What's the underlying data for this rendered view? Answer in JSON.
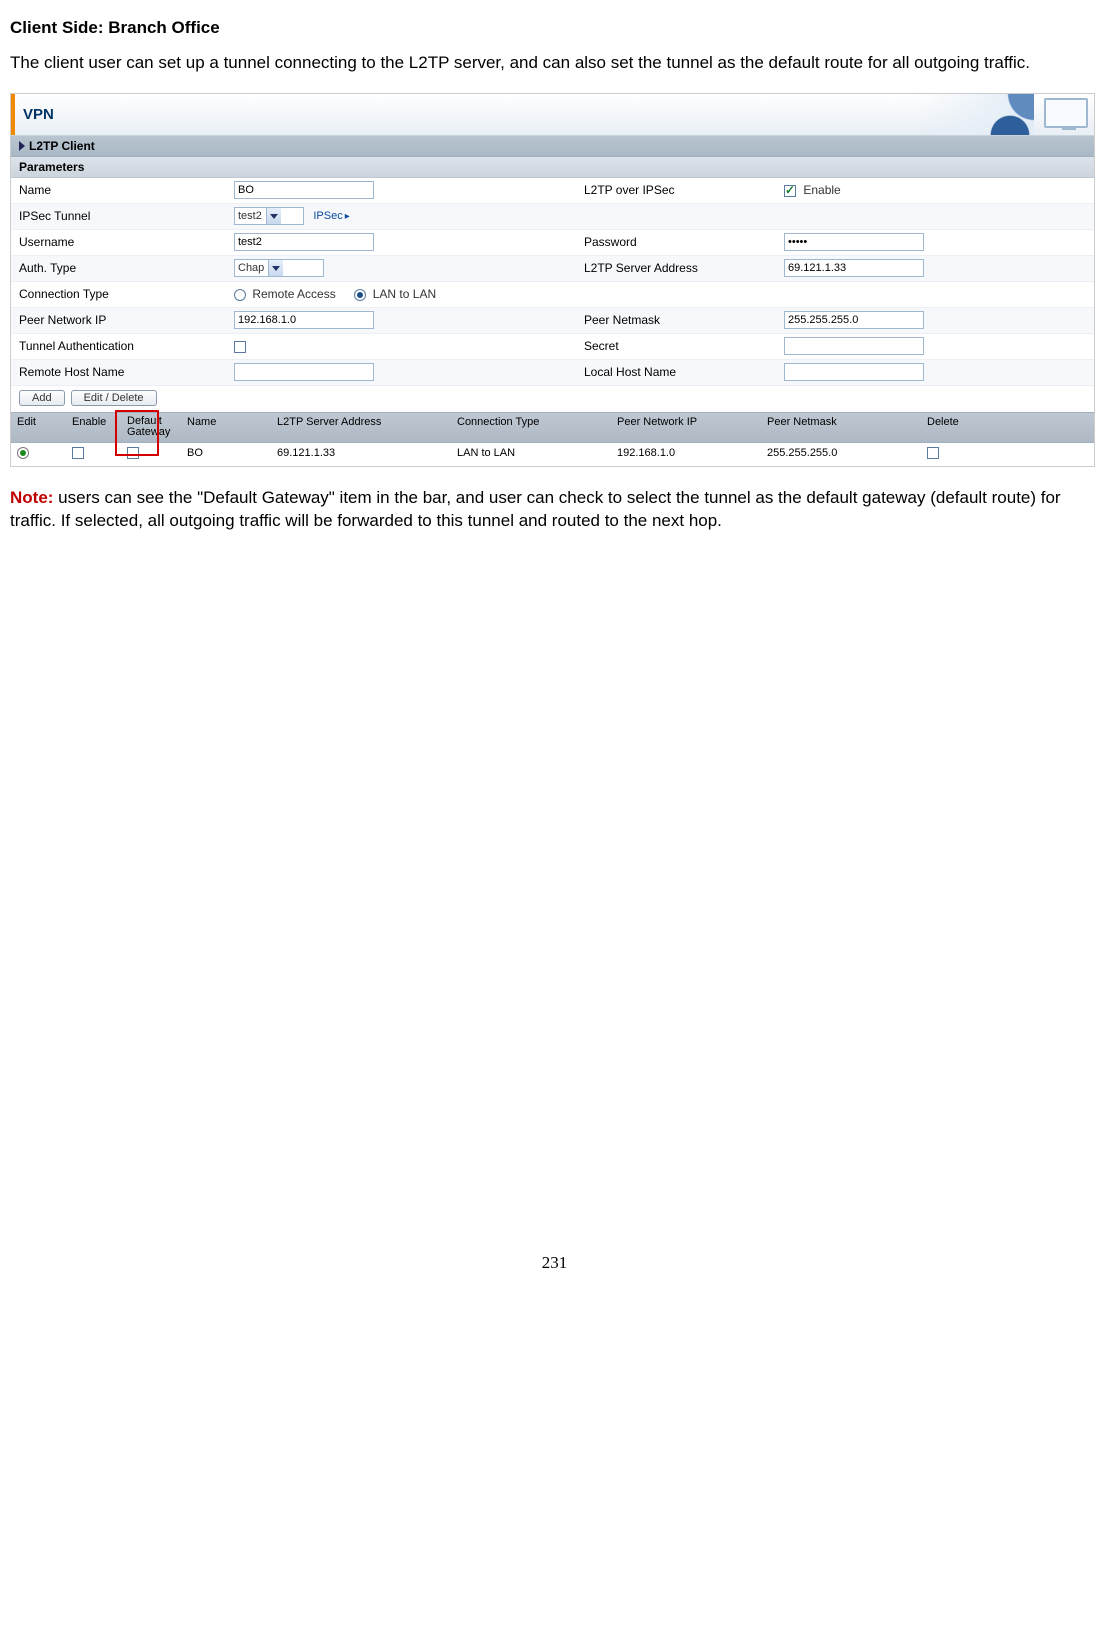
{
  "doc": {
    "heading": "Client Side: Branch Office",
    "intro": "The client user can set up a tunnel connecting to the L2TP server, and can also set the tunnel as the default route for all outgoing traffic.",
    "note_label": "Note:",
    "note_body": " users can see the \"Default Gateway\" item in the bar, and user can check to select the tunnel as the default gateway (default route) for traffic. If selected, all outgoing traffic will be forwarded to this tunnel and routed to the next hop.",
    "page_number": "231"
  },
  "panel": {
    "header": "VPN",
    "section": "L2TP Client",
    "parameters_label": "Parameters",
    "labels": {
      "name": "Name",
      "l2tp_over_ipsec": "L2TP over IPSec",
      "enable": "Enable",
      "ipsec_tunnel": "IPSec Tunnel",
      "ipsec_link": "IPSec",
      "username": "Username",
      "password": "Password",
      "auth_type": "Auth. Type",
      "l2tp_server_addr": "L2TP Server Address",
      "connection_type": "Connection Type",
      "remote_access": "Remote Access",
      "lan_to_lan": "LAN to LAN",
      "peer_network_ip": "Peer Network IP",
      "peer_netmask": "Peer Netmask",
      "tunnel_auth": "Tunnel Authentication",
      "secret": "Secret",
      "remote_host": "Remote Host Name",
      "local_host": "Local Host Name"
    },
    "values": {
      "name": "BO",
      "ipsec_tunnel": "test2",
      "username": "test2",
      "password": "•••••",
      "auth_type": "Chap",
      "server_addr": "69.121.1.33",
      "peer_ip": "192.168.1.0",
      "peer_netmask": "255.255.255.0"
    },
    "buttons": {
      "add": "Add",
      "edit_delete": "Edit / Delete"
    },
    "gridhead": {
      "edit": "Edit",
      "enable": "Enable",
      "default_gateway": "Default Gateway",
      "name": "Name",
      "server": "L2TP Server Address",
      "conn": "Connection Type",
      "peer_ip": "Peer Network IP",
      "peer_mask": "Peer Netmask",
      "delete": "Delete"
    },
    "gridrow": {
      "name": "BO",
      "server": "69.121.1.33",
      "conn": "LAN to LAN",
      "peer_ip": "192.168.1.0",
      "peer_mask": "255.255.255.0"
    }
  }
}
